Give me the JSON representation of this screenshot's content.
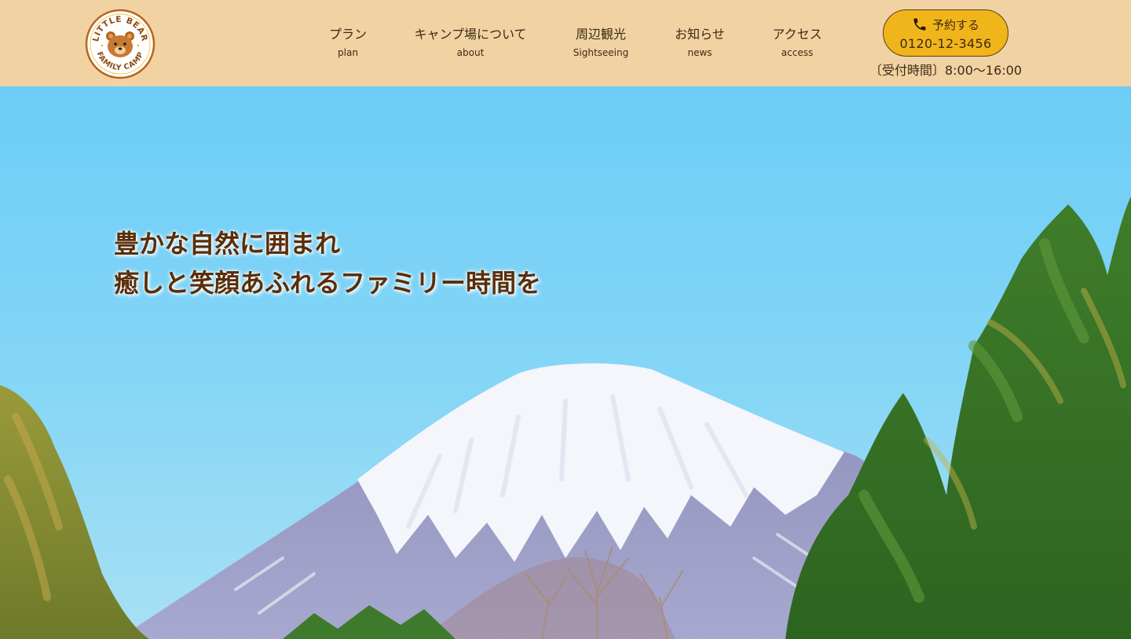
{
  "logo": {
    "text_top": "LITTLE BEAR",
    "text_bottom": "FAMILY CAMP"
  },
  "nav": [
    {
      "ja": "プラン",
      "en": "plan"
    },
    {
      "ja": "キャンプ場について",
      "en": "about"
    },
    {
      "ja": "周辺観光",
      "en": "Sightseeing"
    },
    {
      "ja": "お知らせ",
      "en": "news"
    },
    {
      "ja": "アクセス",
      "en": "access"
    }
  ],
  "reserve": {
    "label": "予約する",
    "phone": "0120-12-3456",
    "hours": "〔受付時間〕8:00〜16:00",
    "icon": "phone-icon"
  },
  "hero": {
    "line1": "豊かな自然に囲まれ",
    "line2": "癒しと笑顔あふれるファミリー時間を"
  },
  "colors": {
    "header_bg": "#f1d2a3",
    "reserve_bg": "#f1b51c",
    "text": "#3b2a14",
    "hero_text": "#5a2e0a",
    "sky": "#7ed0f4"
  }
}
